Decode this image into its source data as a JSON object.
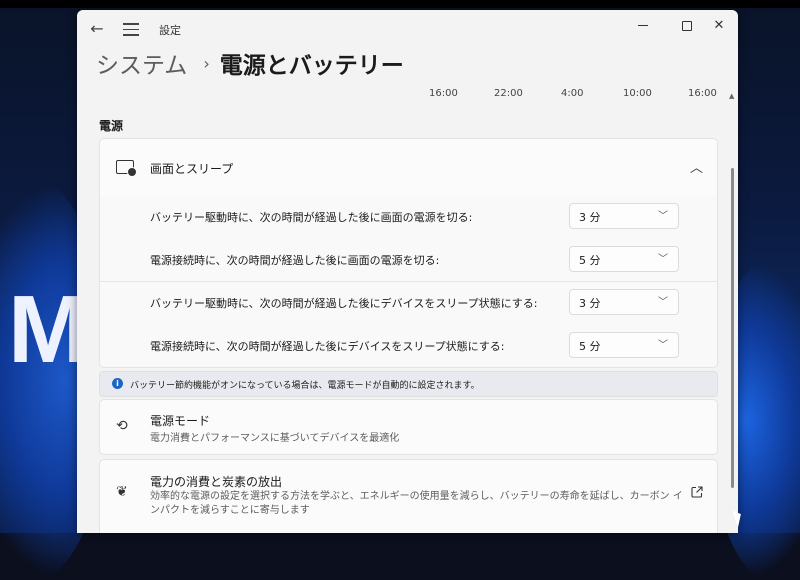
{
  "window": {
    "title": "設定",
    "back_icon": "←"
  },
  "breadcrumb": {
    "parent": "システム",
    "separator": "›",
    "current": "電源とバッテリー"
  },
  "graph_times": [
    "16:00",
    "22:00",
    "4:00",
    "10:00",
    "16:00"
  ],
  "section_power": "電源",
  "screen_sleep": {
    "title": "画面とスリープ",
    "rows": [
      {
        "label": "バッテリー駆動時に、次の時間が経過した後に画面の電源を切る:",
        "value": "3 分"
      },
      {
        "label": "電源接続時に、次の時間が経過した後に画面の電源を切る:",
        "value": "5 分"
      },
      {
        "label": "バッテリー駆動時に、次の時間が経過した後にデバイスをスリープ状態にする:",
        "value": "3 分"
      },
      {
        "label": "電源接続時に、次の時間が経過した後にデバイスをスリープ状態にする:",
        "value": "5 分"
      }
    ]
  },
  "info": {
    "text": "バッテリー節約機能がオンになっている場合は、電源モードが自動的に設定されます。"
  },
  "power_mode": {
    "title": "電源モード",
    "subtitle": "電力消費とパフォーマンスに基づいてデバイスを最適化"
  },
  "energy": {
    "title": "電力の消費と炭素の放出",
    "description": "効率的な電源の設定を選択する方法を学ぶと、エネルギーの使用量を減らし、バッテリーの寿命を延ばし、カーボン インパクトを減らすことに寄与します"
  },
  "desktop_text": "M"
}
